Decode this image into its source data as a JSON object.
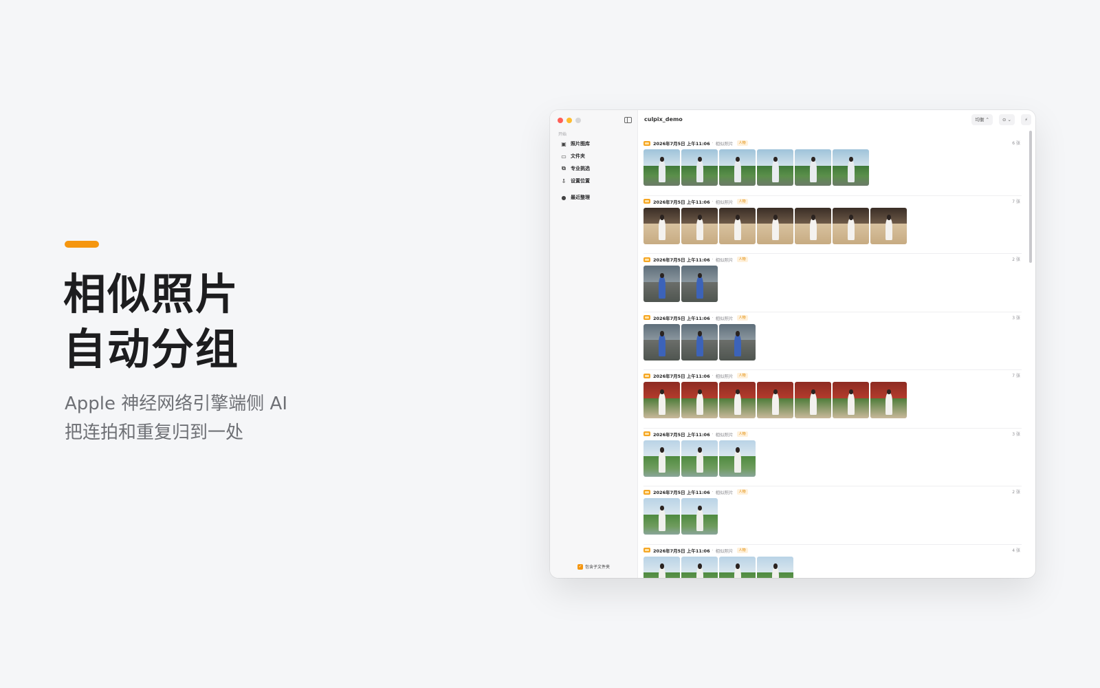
{
  "promo": {
    "title_line1": "相似照片",
    "title_line2": "自动分组",
    "subtitle_line1": "Apple 神经网络引擎端侧 AI",
    "subtitle_line2": "把连拍和重复归到一处",
    "accent_color": "#f5960f"
  },
  "window": {
    "folder_name": "culpix_demo",
    "toolbar": {
      "mode_label": "均衡 ⌃",
      "filter_label": "⊙ ⌄",
      "magic_icon": "wand-icon"
    }
  },
  "sidebar": {
    "section_label": "开始",
    "items": [
      {
        "label": "照片图库",
        "icon": "photo-library-icon"
      },
      {
        "label": "文件夹",
        "icon": "folder-icon"
      },
      {
        "label": "专业挑选",
        "icon": "pro-pick-icon"
      },
      {
        "label": "设置位置",
        "icon": "location-icon"
      }
    ],
    "recent_label": "最近整理",
    "include_subfolders_label": "包含子文件夹",
    "include_subfolders_checked": true
  },
  "groups": [
    {
      "date": "2026年7月5日 上午11:06",
      "kind": "相似照片",
      "badge": "人物",
      "count": "6 张",
      "thumbs": [
        "lake",
        "lake",
        "lake",
        "lake",
        "lake",
        "lake"
      ]
    },
    {
      "date": "2026年7月5日 上午11:06",
      "kind": "相似照片",
      "badge": "人物",
      "count": "7 张",
      "thumbs": [
        "sand",
        "sand",
        "sand",
        "sand",
        "sand",
        "sand",
        "sand"
      ]
    },
    {
      "date": "2026年7月5日 上午11:06",
      "kind": "相似照片",
      "badge": "人物",
      "count": "2 张",
      "thumbs": [
        "blue",
        "blue"
      ]
    },
    {
      "date": "2026年7月5日 上午11:06",
      "kind": "相似照片",
      "badge": "人物",
      "count": "3 张",
      "thumbs": [
        "blue",
        "blue",
        "blue"
      ]
    },
    {
      "date": "2026年7月5日 上午11:06",
      "kind": "相似照片",
      "badge": "人物",
      "count": "7 张",
      "thumbs": [
        "red",
        "red",
        "red",
        "red",
        "red",
        "red",
        "red"
      ]
    },
    {
      "date": "2026年7月5日 上午11:06",
      "kind": "相似照片",
      "badge": "人物",
      "count": "3 张",
      "thumbs": [
        "pond",
        "pond",
        "pond"
      ]
    },
    {
      "date": "2026年7月5日 上午11:06",
      "kind": "相似照片",
      "badge": "人物",
      "count": "2 张",
      "thumbs": [
        "pond",
        "pond"
      ]
    },
    {
      "date": "2026年7月5日 上午11:06",
      "kind": "相似照片",
      "badge": "人物",
      "count": "4 张",
      "thumbs": [
        "pond",
        "pond",
        "pond",
        "pond"
      ]
    }
  ]
}
